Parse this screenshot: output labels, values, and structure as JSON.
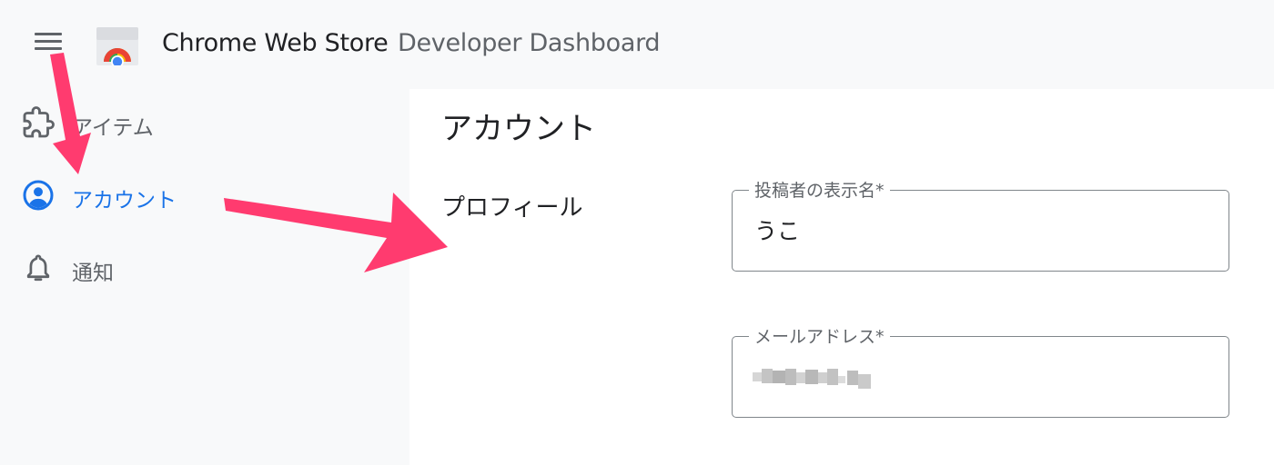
{
  "header": {
    "title_main": "Chrome Web Store",
    "title_sub": "Developer Dashboard"
  },
  "sidebar": {
    "items": [
      {
        "label": "アイテム",
        "icon": "puzzle-icon",
        "active": false
      },
      {
        "label": "アカウント",
        "icon": "account-circle-icon",
        "active": true
      },
      {
        "label": "通知",
        "icon": "bell-icon",
        "active": false
      }
    ]
  },
  "main": {
    "page_title": "アカウント",
    "section_label": "プロフィール",
    "fields": [
      {
        "label": "投稿者の表示名*",
        "value": "うこ"
      },
      {
        "label": "メールアドレス*",
        "value": ""
      }
    ]
  },
  "colors": {
    "accent": "#1a73e8",
    "annotation_arrow": "#ff3b6f",
    "sidebar_bg": "#f8f9fa",
    "panel_bg": "#ffffff"
  }
}
